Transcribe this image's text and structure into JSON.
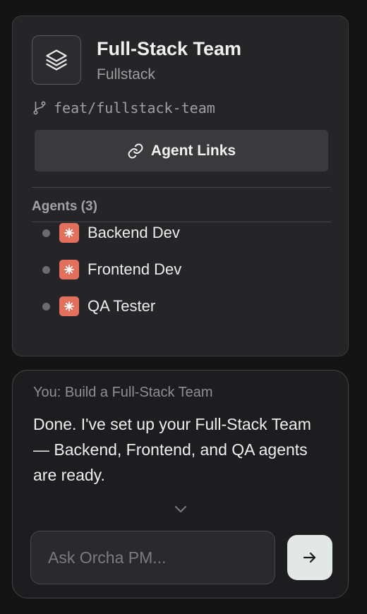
{
  "team": {
    "icon": "layers-icon",
    "title": "Full-Stack Team",
    "subtitle": "Fullstack",
    "branch_icon": "git-branch-icon",
    "branch": "feat/fullstack-team",
    "links_icon": "link-icon",
    "links_label": "Agent Links",
    "agents_heading": "Agents (3)",
    "agents": [
      {
        "name": "Backend Dev",
        "status": "idle",
        "badge_icon": "asterisk-icon"
      },
      {
        "name": "Frontend Dev",
        "status": "idle",
        "badge_icon": "asterisk-icon"
      },
      {
        "name": "QA Tester",
        "status": "idle",
        "badge_icon": "asterisk-icon"
      }
    ]
  },
  "chat": {
    "user_prompt": "You: Build a Full-Stack Team",
    "response": "Done. I've set up your Full-Stack Team — Backend, Frontend, and QA agents are ready.",
    "expand_icon": "chevron-down-icon",
    "input_value": "",
    "input_placeholder": "Ask Orcha PM...",
    "send_icon": "arrow-right-icon"
  },
  "colors": {
    "background": "#141414",
    "card": "#252527",
    "chat_card": "#1d1d1f",
    "agent_badge": "#e2705c",
    "status_dot": "#6c6c6f",
    "send_button": "#e3e7e6",
    "button": "#3a3a3c"
  }
}
